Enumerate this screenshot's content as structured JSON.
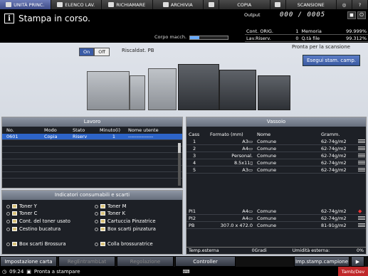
{
  "tabs": [
    {
      "label": "UNITÀ PRINC.",
      "icon": "printer-icon",
      "active": true
    },
    {
      "label": "ELENCO LAV.",
      "icon": "list-icon"
    },
    {
      "label": "RICHIAMARE",
      "icon": "recall-icon"
    },
    {
      "label": "ARCHIVIA",
      "icon": "archive-icon"
    },
    {
      "label": "",
      "icon": "copy-icon"
    },
    {
      "label": "COPIA",
      "icon": "copy-icon"
    },
    {
      "label": "",
      "icon": "scan-icon"
    },
    {
      "label": "SCANSIONE",
      "icon": "scan-icon"
    },
    {
      "label": "",
      "icon": "globe-icon"
    },
    {
      "label": "?",
      "icon": "help-icon"
    }
  ],
  "header": {
    "message": "Stampa in corso.",
    "corpo_label": "Corpo macch.",
    "corpo_progress": 0.25,
    "output_label": "Output",
    "output_value": "000 / 0005",
    "stats": [
      [
        "Cont. ORIG.",
        "1",
        "Memoria",
        "99.999%"
      ],
      [
        "Lav.Riserv.",
        "0",
        "Q.tà file",
        "99.312%"
      ]
    ]
  },
  "main": {
    "toggle_on": "On",
    "toggle_off": "Off",
    "riscald": "Riscaldat. PB",
    "pronta": "Pronta per la scansione",
    "esegui": "Esegui stam. camp."
  },
  "lavoro": {
    "title": "Lavoro",
    "headers": [
      "No.",
      "Modo",
      "Stato",
      "Minuto(i)",
      "Nome utente"
    ],
    "rows": [
      [
        "0601",
        "Copia",
        "Riserv",
        "1",
        "---------------"
      ],
      [
        "",
        "",
        "",
        "",
        ""
      ],
      [
        "",
        "",
        "",
        "",
        ""
      ],
      [
        "",
        "",
        "",
        "",
        ""
      ],
      [
        "",
        "",
        "",
        "",
        ""
      ],
      [
        "",
        "",
        "",
        "",
        ""
      ],
      [
        "",
        "",
        "",
        "",
        ""
      ]
    ]
  },
  "consumabili": {
    "title": "Indicatori consumabili e scarti",
    "items": [
      "Toner Y",
      "Toner M",
      "Toner C",
      "Toner K",
      "Cont. del toner usato",
      "Cartuccia Pinzatrice",
      "Cestino bucatura",
      "Box scarti pinzatura",
      "Box scarti Brossura",
      "Colla brossuratrice"
    ]
  },
  "vassoio": {
    "title": "Vassoio",
    "headers": [
      "Cass",
      "Formato (mm)",
      "Nome",
      "Gramm."
    ],
    "rows": [
      [
        "1",
        "A3▭",
        "Comune",
        "62-74g/m2"
      ],
      [
        "2",
        "A4▭",
        "Comune",
        "62-74g/m2"
      ],
      [
        "3",
        "Personal.",
        "Comune",
        "62-74g/m2"
      ],
      [
        "4",
        "8.5x11▯",
        "Comune",
        "62-74g/m2"
      ],
      [
        "5",
        "A3▭",
        "Comune",
        "62-74g/m2"
      ]
    ],
    "rows2": [
      [
        "PI1",
        "A4▭",
        "Comune",
        "62-74g/m2"
      ],
      [
        "PI2",
        "A4▭",
        "Comune",
        "62-74g/m2"
      ],
      [
        "PB",
        "307.0 x 472.0",
        "Comune",
        "81-91g/m2"
      ]
    ],
    "temp_label": "Temp.esterna",
    "temp_value": "0Gradi",
    "umid_label": "Umidità esterna:",
    "umid_value": "0%"
  },
  "bottom": {
    "b1": "Impostazione carta",
    "b2": "RegEntrambLat",
    "b3": "Regolazione",
    "b4": "Controller",
    "b5": "Imp.stamp.campione",
    "b6": "▶"
  },
  "status": {
    "time": "09:24",
    "text": "Pronta a stampare",
    "tamb": "Tamb/Dev"
  }
}
